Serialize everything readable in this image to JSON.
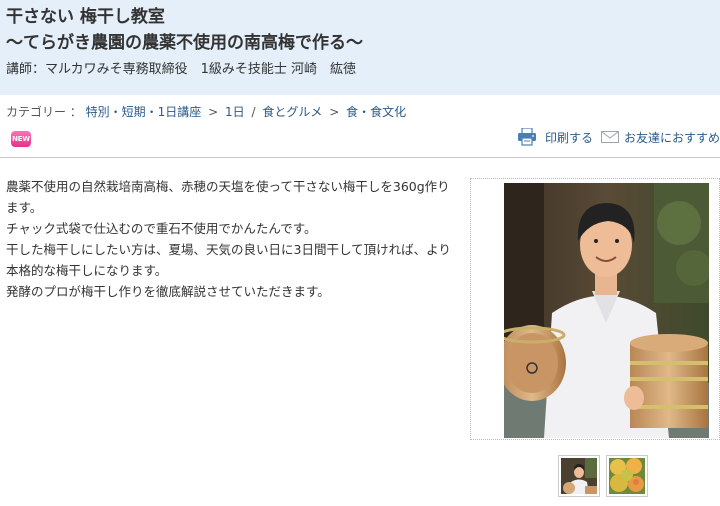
{
  "header": {
    "title_line1": "干さない 梅干し教室",
    "title_line2": "～てらがき農園の農薬不使用の南高梅で作る～",
    "instructor": "講師：マルカワみそ専務取締役　1級みそ技能士 河崎　紘徳"
  },
  "breadcrumb": {
    "label": "カテゴリー ：",
    "items": [
      "特別・短期・1日講座",
      "1日",
      "食とグルメ",
      "食・食文化"
    ],
    "separators": [
      ">",
      "/",
      ">"
    ]
  },
  "badge": {
    "label": "NEW"
  },
  "tools": {
    "print_label": "印刷する",
    "share_label": "お友達におすすめ"
  },
  "description": {
    "lines": [
      "農薬不使用の自然栽培南高梅、赤穂の天塩を使って干さない梅干しを360g作ります。",
      "チャック式袋で仕込むので重石不使用でかんたんです。",
      "干した梅干しにしたい方は、夏場、天気の良い日に3日間干して頂ければ、より本格的な梅干しになります。",
      "発酵のプロが梅干し作りを徹底解説させていただきます。"
    ]
  },
  "colors": {
    "header_bg": "#e4eff9",
    "link": "#2a5a8a",
    "badge": "#e8308c"
  }
}
